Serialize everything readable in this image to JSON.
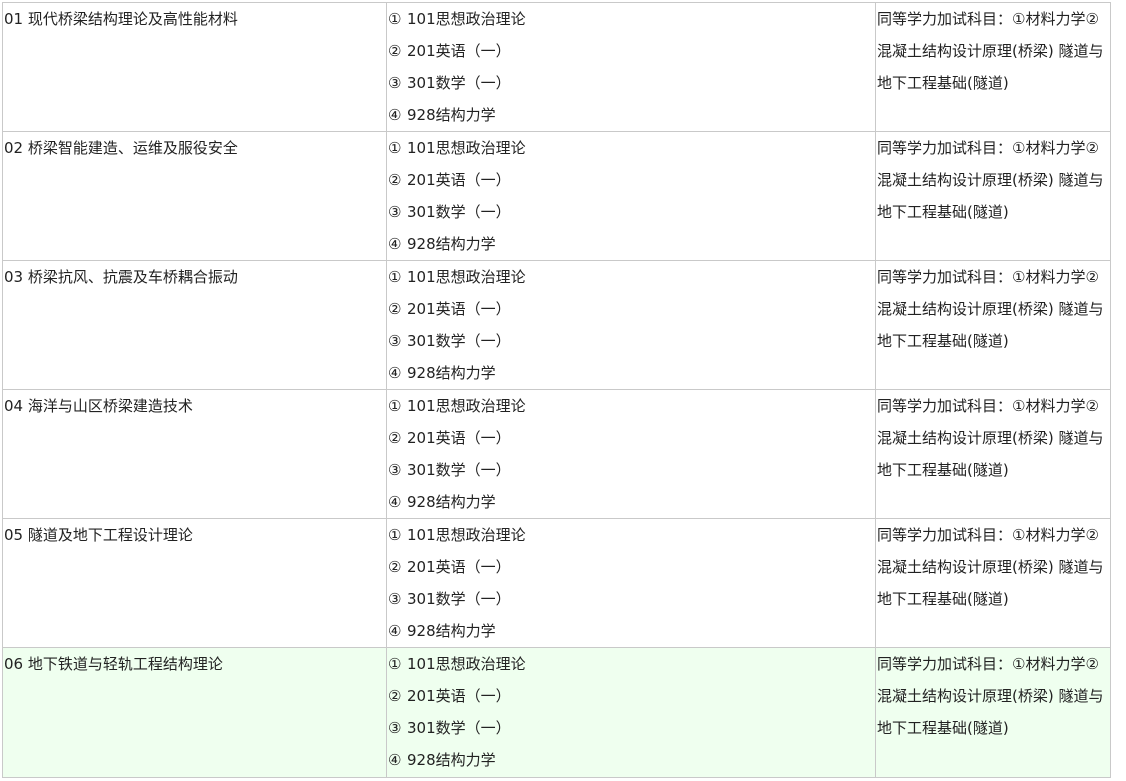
{
  "table": {
    "rows": [
      {
        "direction": "01 现代桥梁结构理论及高性能材料",
        "subjects": [
          {
            "num": "①",
            "text": "101思想政治理论"
          },
          {
            "num": "②",
            "text": "201英语（一）"
          },
          {
            "num": "③",
            "text": "301数学（一）"
          },
          {
            "num": "④",
            "text": "928结构力学"
          }
        ],
        "notes": "同等学力加试科目：①材料力学②混凝土结构设计原理(桥梁) 隧道与地下工程基础(隧道)"
      },
      {
        "direction": "02 桥梁智能建造、运维及服役安全",
        "subjects": [
          {
            "num": "①",
            "text": "101思想政治理论"
          },
          {
            "num": "②",
            "text": "201英语（一）"
          },
          {
            "num": "③",
            "text": "301数学（一）"
          },
          {
            "num": "④",
            "text": "928结构力学"
          }
        ],
        "notes": "同等学力加试科目：①材料力学②混凝土结构设计原理(桥梁) 隧道与地下工程基础(隧道)"
      },
      {
        "direction": "03 桥梁抗风、抗震及车桥耦合振动",
        "subjects": [
          {
            "num": "①",
            "text": "101思想政治理论"
          },
          {
            "num": "②",
            "text": "201英语（一）"
          },
          {
            "num": "③",
            "text": "301数学（一）"
          },
          {
            "num": "④",
            "text": "928结构力学"
          }
        ],
        "notes": "同等学力加试科目：①材料力学②混凝土结构设计原理(桥梁) 隧道与地下工程基础(隧道)"
      },
      {
        "direction": "04 海洋与山区桥梁建造技术",
        "subjects": [
          {
            "num": "①",
            "text": "101思想政治理论"
          },
          {
            "num": "②",
            "text": "201英语（一）"
          },
          {
            "num": "③",
            "text": "301数学（一）"
          },
          {
            "num": "④",
            "text": "928结构力学"
          }
        ],
        "notes": "同等学力加试科目：①材料力学②混凝土结构设计原理(桥梁) 隧道与地下工程基础(隧道)"
      },
      {
        "direction": "05 隧道及地下工程设计理论",
        "subjects": [
          {
            "num": "①",
            "text": "101思想政治理论"
          },
          {
            "num": "②",
            "text": "201英语（一）"
          },
          {
            "num": "③",
            "text": "301数学（一）"
          },
          {
            "num": "④",
            "text": "928结构力学"
          }
        ],
        "notes": "同等学力加试科目：①材料力学②混凝土结构设计原理(桥梁) 隧道与地下工程基础(隧道)"
      },
      {
        "direction": "06 地下铁道与轻轨工程结构理论",
        "subjects": [
          {
            "num": "①",
            "text": "101思想政治理论"
          },
          {
            "num": "②",
            "text": "201英语（一）"
          },
          {
            "num": "③",
            "text": "301数学（一）"
          },
          {
            "num": "④",
            "text": "928结构力学"
          }
        ],
        "notes": "同等学力加试科目：①材料力学②混凝土结构设计原理(桥梁) 隧道与地下工程基础(隧道)"
      }
    ],
    "highlight_row_color": "#efffef",
    "border_color": "#c9c9c9"
  }
}
